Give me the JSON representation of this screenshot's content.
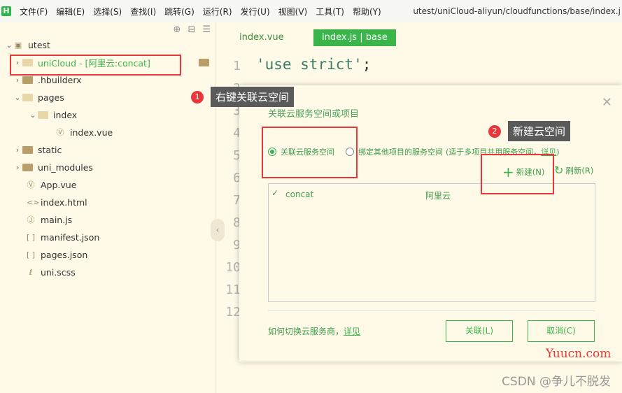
{
  "menubar": {
    "logo": "H",
    "items": [
      "文件(F)",
      "编辑(E)",
      "选择(S)",
      "查找(I)",
      "跳转(G)",
      "运行(R)",
      "发行(U)",
      "视图(V)",
      "工具(T)",
      "帮助(Y)"
    ],
    "path": "utest/uniCloud-aliyun/cloudfunctions/base/index.j"
  },
  "sidebar": {
    "project": "utest",
    "unicloud": "uniCloud - [阿里云:concat]",
    "hbuilderx": ".hbuilderx",
    "pages": "pages",
    "index_folder": "index",
    "index_vue": "index.vue",
    "static": "static",
    "uni_modules": "uni_modules",
    "app_vue": "App.vue",
    "index_html": "index.html",
    "main_js": "main.js",
    "manifest": "manifest.json",
    "pages_json": "pages.json",
    "uni_scss": "uni.scss"
  },
  "editor": {
    "tabs": [
      "index.vue",
      "index.js | base"
    ],
    "line_numbers": [
      "1",
      "2",
      "3",
      "4",
      "5",
      "6",
      "7",
      "8",
      "9",
      "10",
      "11",
      "12"
    ],
    "code_line1": "'use strict'",
    "code_line1_semicolon": ";"
  },
  "callouts": {
    "one_num": "1",
    "one_text": "右键关联云空间",
    "two_num": "2",
    "two_text": "新建云空间"
  },
  "dialog": {
    "title": "关联云服务空间或项目",
    "radio1": "关联云服务空间",
    "radio2": "绑定其他项目的服务空间",
    "radio2_note": "(适于多项目共用服务空间，",
    "radio2_link": "详见",
    "radio2_close": ")",
    "new_label": "新建(N)",
    "refresh_label": "刷新(R)",
    "list": [
      {
        "name": "concat",
        "provider": "阿里云"
      }
    ],
    "help_text": "如何切换云服务商，",
    "help_link": "详见",
    "ok_label": "关联(L)",
    "cancel_label": "取消(C)"
  },
  "watermarks": {
    "site": "Yuucn.com",
    "csdn": "CSDN @争儿不脱发"
  },
  "colors": {
    "accent_green": "#3ab54a",
    "highlight_red": "#e8363a",
    "background": "#fffae8"
  }
}
